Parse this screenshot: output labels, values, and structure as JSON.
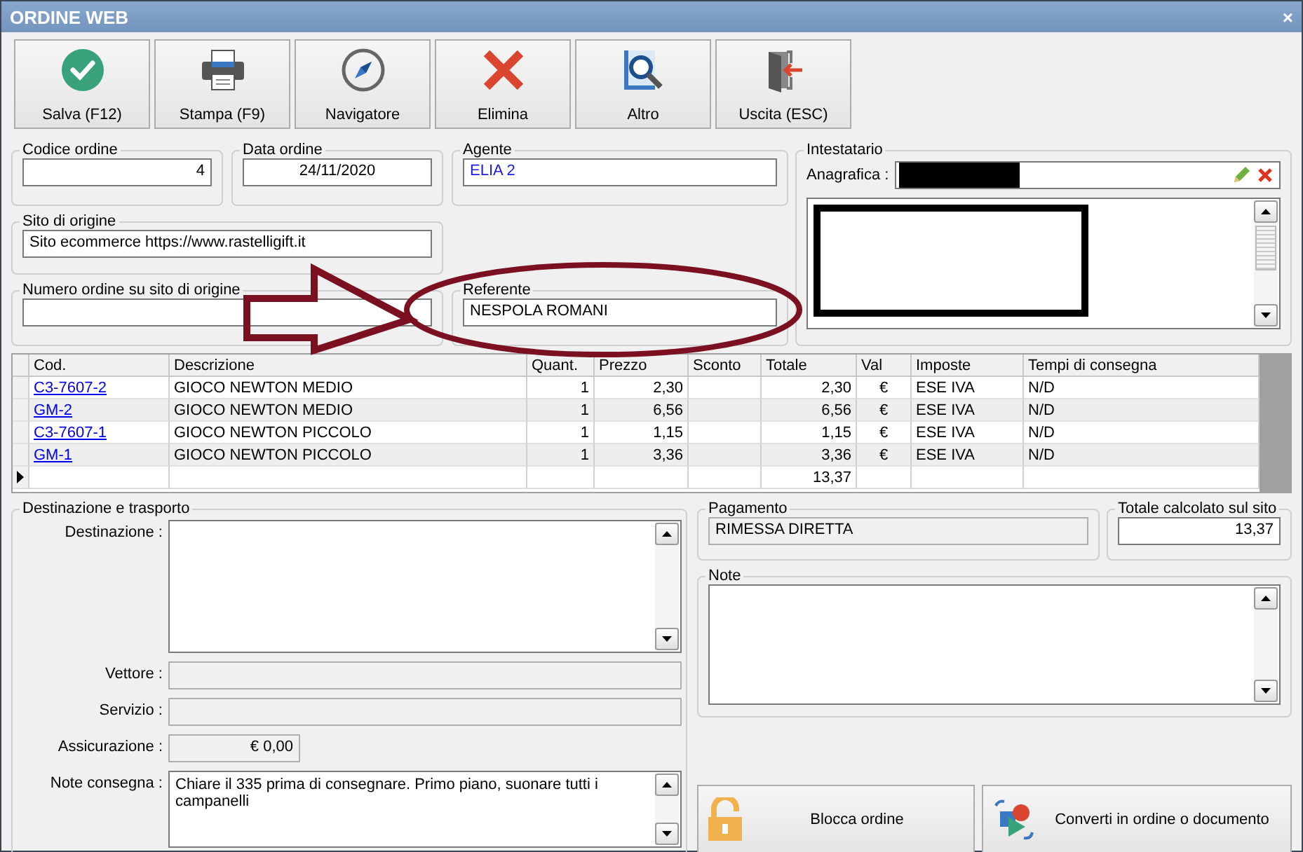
{
  "window": {
    "title": "ORDINE WEB",
    "close": "×"
  },
  "toolbar": [
    {
      "label": "Salva (F12)"
    },
    {
      "label": "Stampa (F9)"
    },
    {
      "label": "Navigatore"
    },
    {
      "label": "Elimina"
    },
    {
      "label": "Altro"
    },
    {
      "label": "Uscita (ESC)"
    }
  ],
  "codice_ordine": {
    "label": "Codice ordine",
    "value": "4"
  },
  "data_ordine": {
    "label": "Data ordine",
    "value": "24/11/2020"
  },
  "agente": {
    "label": "Agente",
    "value": "ELIA 2"
  },
  "sito_di_origine": {
    "label": "Sito di origine",
    "value": "Sito ecommerce https://www.rastelligift.it"
  },
  "numero_ordine": {
    "label": "Numero ordine su sito di origine"
  },
  "referente": {
    "label": "Referente",
    "value": "NESPOLA ROMANI"
  },
  "intestatario": {
    "title": "Intestatario",
    "anagrafica_label": "Anagrafica :",
    "redacted": true
  },
  "table": {
    "columns": [
      "Cod.",
      "Descrizione",
      "Quant.",
      "Prezzo",
      "Sconto",
      "Totale",
      "Val",
      "Imposte",
      "Tempi di consegna"
    ],
    "rows": [
      {
        "cod": "C3-7607-2",
        "descrizione": "GIOCO NEWTON MEDIO",
        "quant": "1",
        "prezzo": "2,30",
        "totale": "2,30",
        "val": "€",
        "imposte": "ESE IVA",
        "tempi": "N/D"
      },
      {
        "cod": "GM-2",
        "descrizione": "GIOCO NEWTON MEDIO",
        "quant": "1",
        "prezzo": "6,56",
        "totale": "6,56",
        "val": "€",
        "imposte": "ESE IVA",
        "tempi": "N/D"
      },
      {
        "cod": "C3-7607-1",
        "descrizione": "GIOCO NEWTON PICCOLO",
        "quant": "1",
        "prezzo": "1,15",
        "totale": "1,15",
        "val": "€",
        "imposte": "ESE IVA",
        "tempi": "N/D"
      },
      {
        "cod": "GM-1",
        "descrizione": "GIOCO NEWTON PICCOLO",
        "quant": "1",
        "prezzo": "3,36",
        "totale": "3,36",
        "val": "€",
        "imposte": "ESE IVA",
        "tempi": "N/D"
      }
    ],
    "total": "13,37"
  },
  "destinazione_e_trasporto": {
    "title": "Destinazione e trasporto",
    "fields": [
      {
        "kind": "memo",
        "label": "Destinazione :",
        "disabled": false
      },
      {
        "kind": "line",
        "label": "Vettore :",
        "disabled": true
      },
      {
        "kind": "line",
        "label": "Servizio :",
        "disabled": true
      },
      {
        "kind": "amount",
        "label": "Assicurazione :",
        "value": "€ 0,00",
        "disabled": true
      },
      {
        "kind": "memo",
        "label": "Note consegna :",
        "value": "Chiare il 335 prima di consegnare. Primo piano, suonare tutti i campanelli",
        "disabled": false
      }
    ]
  },
  "pagamento": {
    "title": "Pagamento",
    "value": "RIMESSA DIRETTA",
    "disabled": true
  },
  "totale_calcolato": {
    "title": "Totale calcolato sul sito",
    "value": "13,37"
  },
  "note": {
    "title": "Note"
  },
  "actions": [
    {
      "label": "Blocca ordine"
    },
    {
      "label": "Converti in ordine o documento"
    }
  ],
  "annotations": [
    {
      "kind": "arrow"
    },
    {
      "kind": "ellipse"
    }
  ]
}
